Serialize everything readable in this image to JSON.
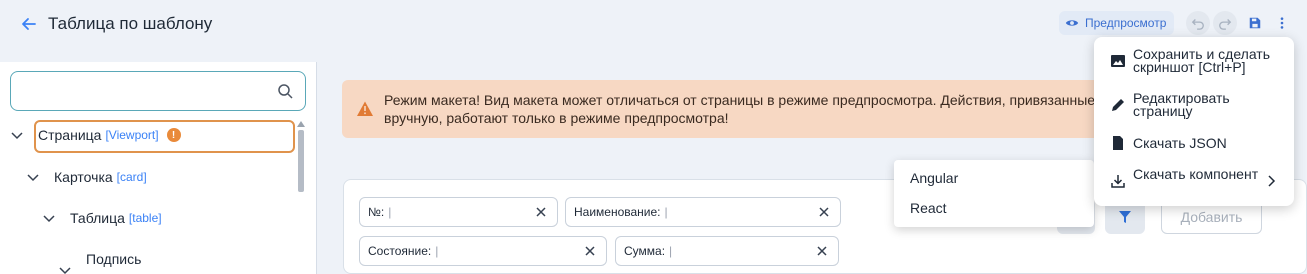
{
  "header": {
    "title": "Таблица по шаблону",
    "preview_label": "Предпросмотр"
  },
  "tree": {
    "search_placeholder": "",
    "items": [
      {
        "label": "Страница",
        "tag": "[Viewport]",
        "warning": "!"
      },
      {
        "label": "Карточка",
        "tag": "[card]"
      },
      {
        "label": "Таблица",
        "tag": "[table]"
      },
      {
        "label": "Подпись",
        "tag": ""
      }
    ]
  },
  "banner": {
    "line1": "Режим макета! Вид макета может отличаться от страницы в режиме предпросмотра. Действия, привязанные",
    "line2": "вручную, работают только в режиме предпросмотра!"
  },
  "filters": [
    {
      "label": "№:"
    },
    {
      "label": "Наименование:"
    },
    {
      "label": "Состояние:"
    },
    {
      "label": "Сумма:"
    }
  ],
  "cursor_glyph": "|",
  "buttons": {
    "add": "Добавить"
  },
  "menu": {
    "items": [
      {
        "label": "Сохранить и сделать скриншот [Ctrl+P]",
        "icon": "image-icon"
      },
      {
        "label": "Редактировать страницу",
        "icon": "pencil-icon"
      },
      {
        "label": "Скачать JSON",
        "icon": "file-icon"
      },
      {
        "label": "Скачать компонент",
        "icon": "download-icon"
      }
    ]
  },
  "submenu": {
    "items": [
      "Angular",
      "React"
    ]
  },
  "colors": {
    "accent": "#3b82f6",
    "warning": "#e98a3a",
    "banner_bg": "#f7d8c3"
  }
}
